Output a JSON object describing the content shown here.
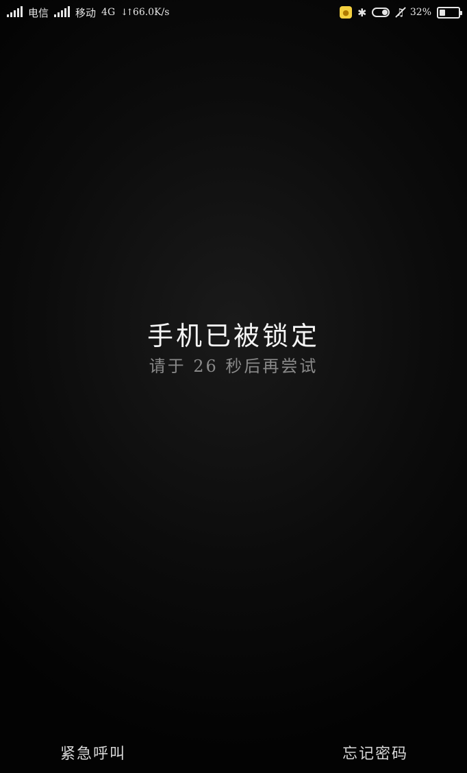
{
  "status_bar": {
    "carrier1": "电信",
    "carrier2": "移动",
    "network_type": "4G",
    "speed": "66.0K/s",
    "battery_percent": "32%",
    "battery_level": 0.32,
    "icons": [
      "signal-icon",
      "signal-icon",
      "data-arrows-icon",
      "app-badge-icon",
      "bluetooth-icon",
      "toggle-icon",
      "bell-muted-icon",
      "battery-icon"
    ]
  },
  "lock": {
    "title": "手机已被锁定",
    "subtitle": "请于 26 秒后再尝试"
  },
  "actions": {
    "emergency": "紧急呼叫",
    "forgot": "忘记密码"
  }
}
